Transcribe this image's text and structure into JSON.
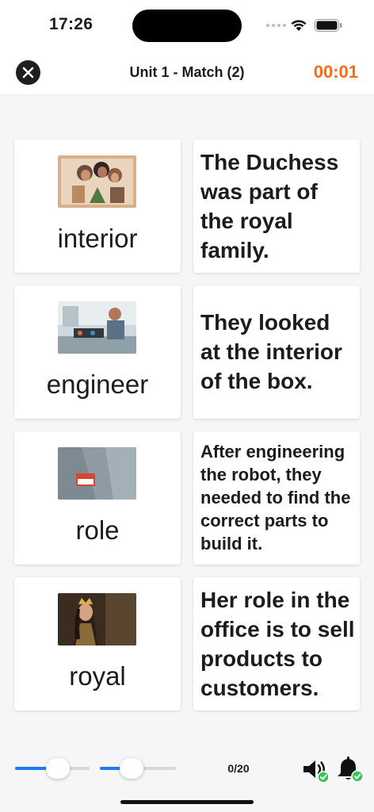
{
  "status_bar": {
    "time": "17:26"
  },
  "header": {
    "title": "Unit 1 - Match (2)",
    "timer": "00:01"
  },
  "words": [
    {
      "label": "interior",
      "icon": "photo-people-looking-into-box"
    },
    {
      "label": "engineer",
      "icon": "photo-engineer-at-workbench"
    },
    {
      "label": "role",
      "icon": "photo-name-badge"
    },
    {
      "label": "royal",
      "icon": "photo-queen-with-crown"
    }
  ],
  "sentences": [
    "The Duchess was part of the royal family.",
    "They looked at the interior of the box.",
    "After engineering the robot, they needed to find the correct parts to build it.",
    "Her role in the office is to sell products to customers."
  ],
  "footer": {
    "progress": "0/20",
    "slider1_level": 0.57,
    "slider2_level": 0.42
  },
  "colors": {
    "accent": "#1e7bf2",
    "timer": "#ff6a13",
    "check": "#34c759"
  }
}
